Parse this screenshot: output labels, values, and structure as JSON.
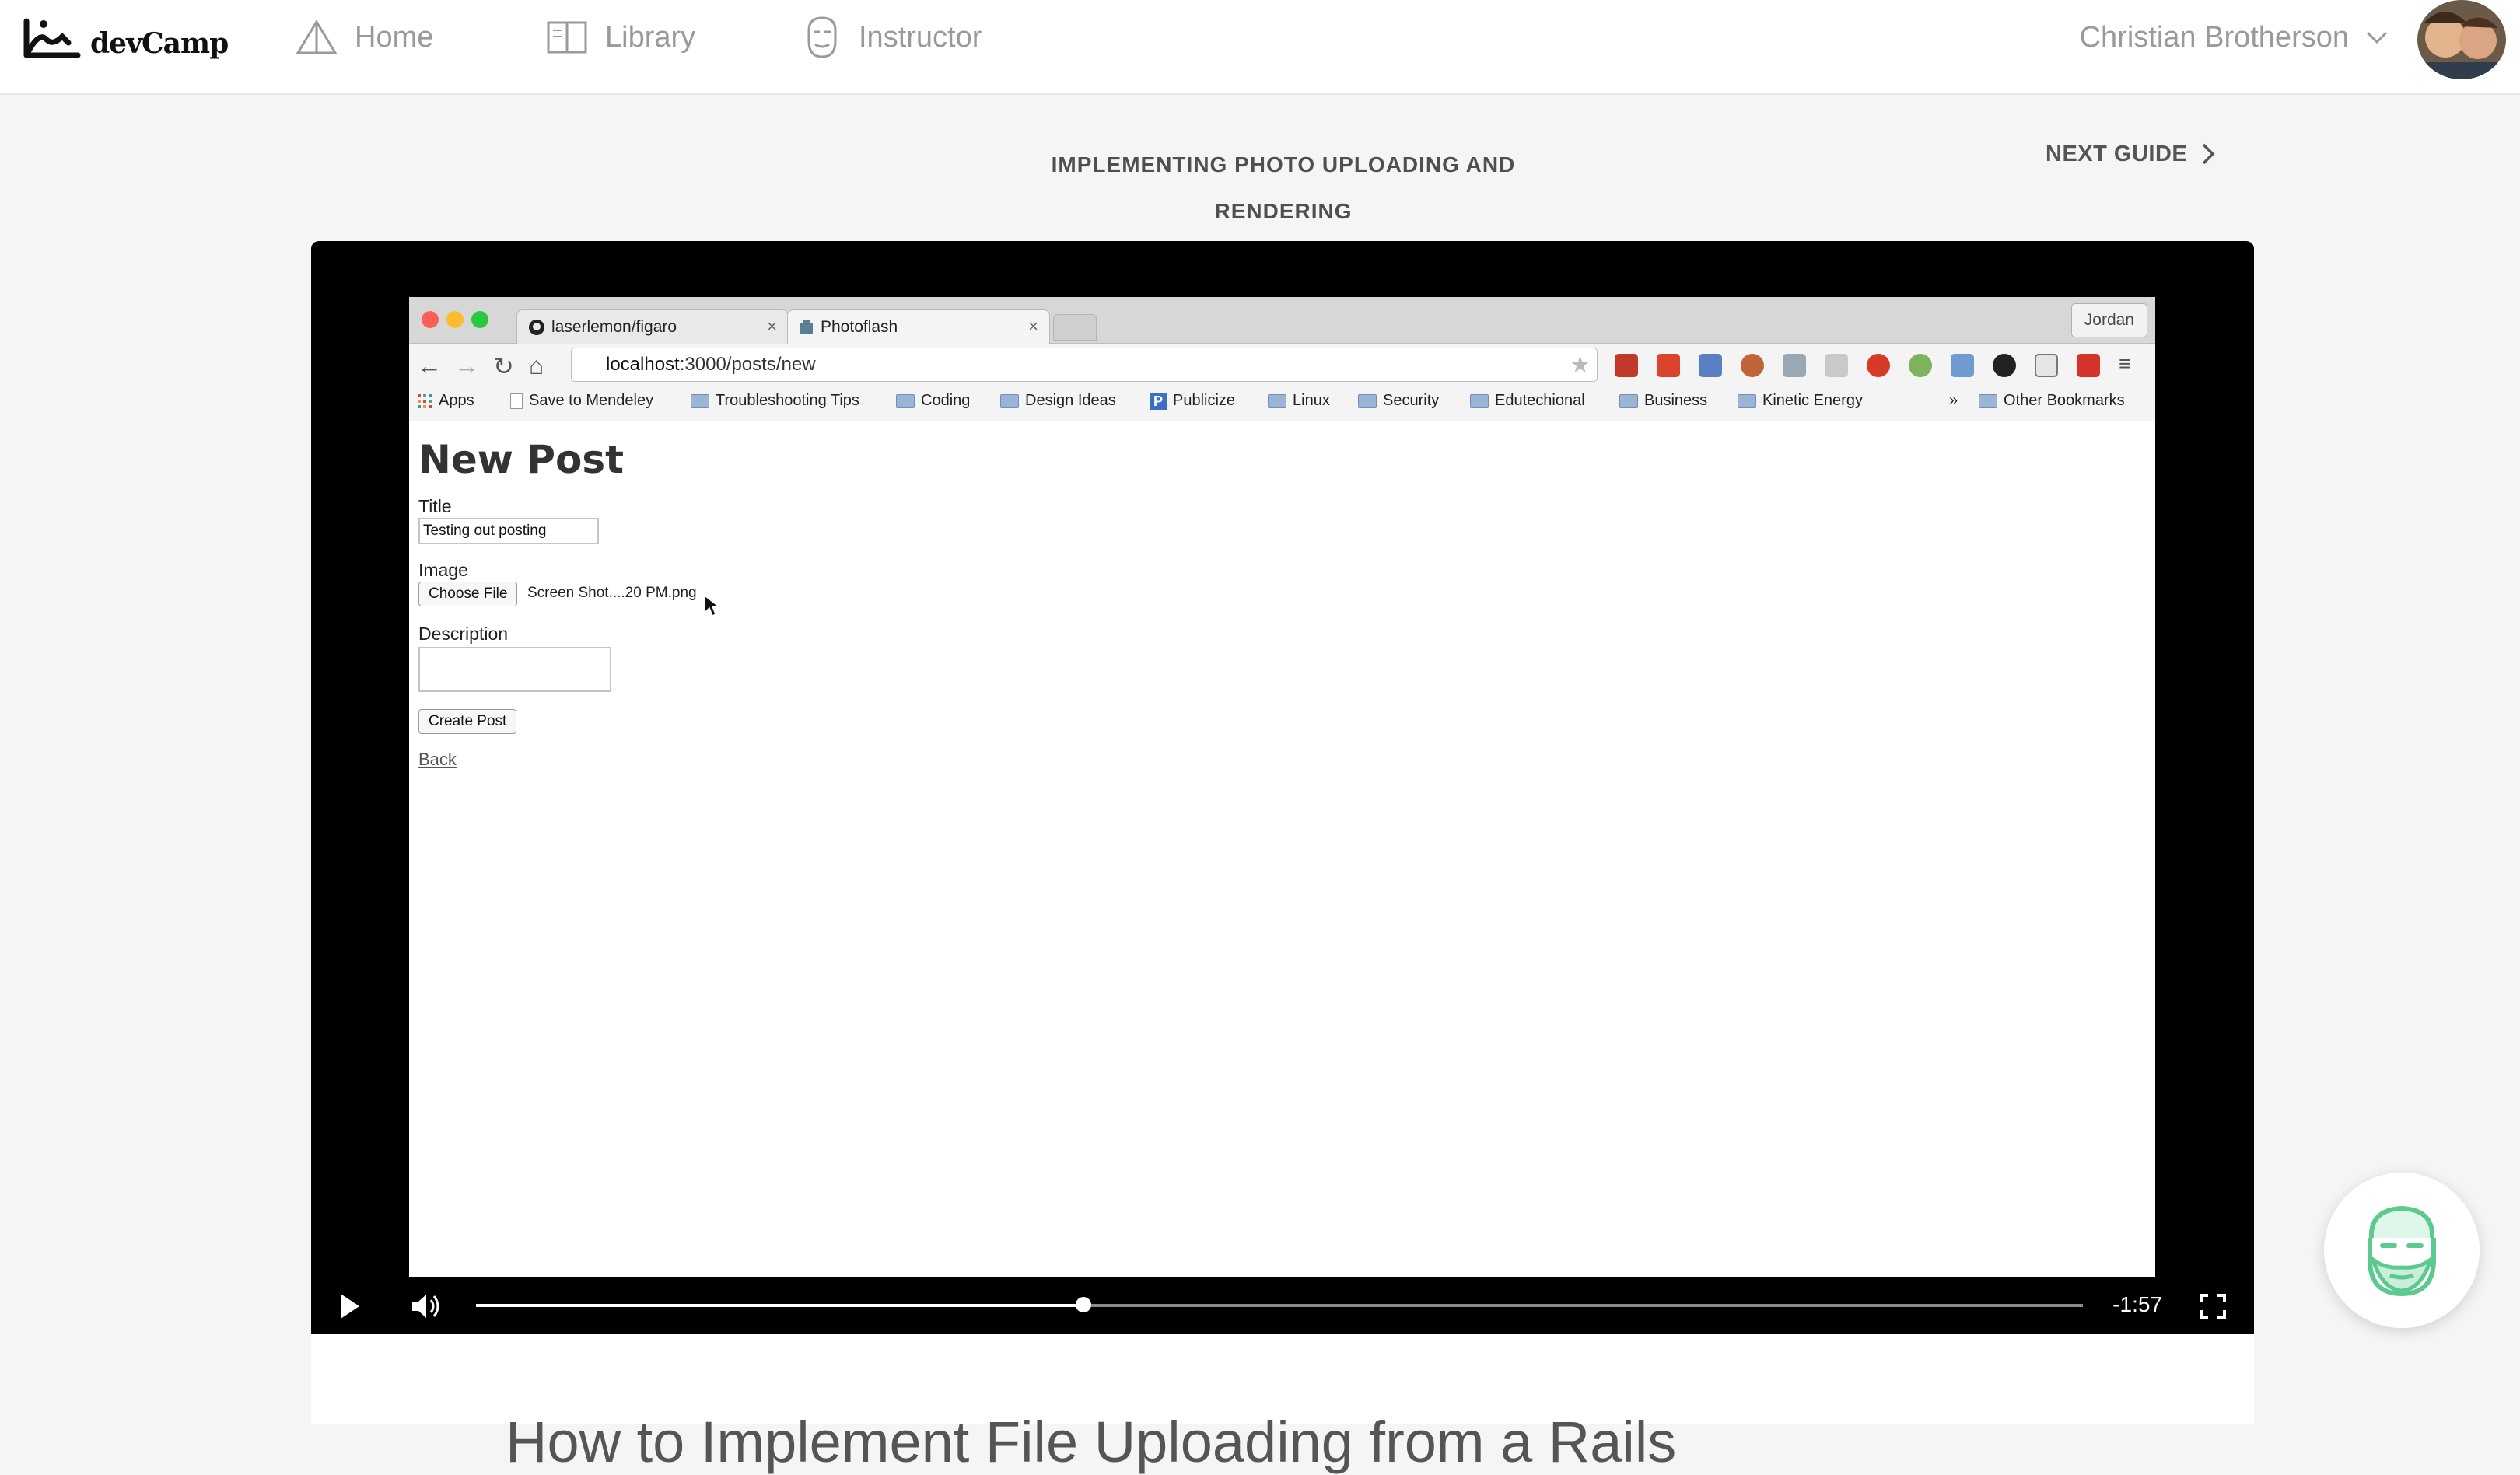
{
  "brand": {
    "name": "devCamp"
  },
  "nav": {
    "home": "Home",
    "library": "Library",
    "instructor": "Instructor"
  },
  "user": {
    "name": "Christian Brotherson"
  },
  "guide": {
    "title_line1": "IMPLEMENTING PHOTO UPLOADING AND",
    "title_line2": "RENDERING",
    "next_label": "NEXT GUIDE"
  },
  "video": {
    "browser": {
      "tabs": [
        {
          "label": "laserlemon/figaro"
        },
        {
          "label": "Photoflash"
        }
      ],
      "profile": "Jordan",
      "url_host": "localhost",
      "url_path": ":3000/posts/new",
      "bookmarks": [
        "Apps",
        "Save to Mendeley",
        "Troubleshooting Tips",
        "Coding",
        "Design Ideas",
        "Publicize",
        "Linux",
        "Security",
        "Edutechional",
        "Business",
        "Kinetic Energy",
        "»",
        "Other Bookmarks"
      ]
    },
    "form": {
      "heading": "New Post",
      "title_label": "Title",
      "title_value": "Testing out posting",
      "image_label": "Image",
      "choose_file": "Choose File",
      "file_name": "Screen Shot....20 PM.png",
      "description_label": "Description",
      "description_value": "",
      "submit": "Create Post",
      "back": "Back"
    },
    "player": {
      "time_remaining": "-1:57",
      "progress": 0.378
    }
  },
  "article": {
    "heading_partial": "How to Implement File Uploading from a Rails"
  },
  "colors": {
    "accent_green": "#5cc98f",
    "video_bg": "#000000"
  }
}
